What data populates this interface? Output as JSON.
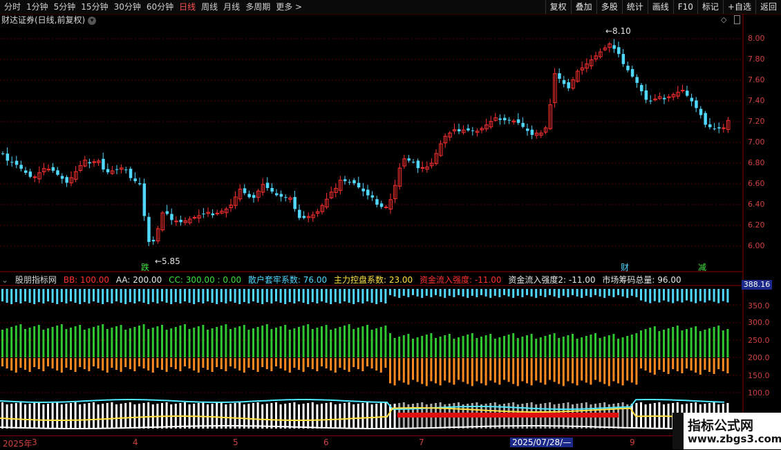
{
  "toolbar": {
    "periods": [
      "分时",
      "1分钟",
      "5分钟",
      "15分钟",
      "30分钟",
      "60分钟",
      "日线",
      "周线",
      "月线",
      "多周期",
      "更多 >"
    ],
    "active_period": "日线",
    "tools": [
      "复权",
      "叠加",
      "多股",
      "统计",
      "画线",
      "F10",
      "标记",
      "+自选",
      "返回"
    ]
  },
  "title": "财达证券(日线,前复权)",
  "price_axis": [
    "8.00",
    "7.80",
    "7.60",
    "7.40",
    "7.20",
    "7.00",
    "6.80",
    "6.60",
    "6.40",
    "6.20",
    "6.00"
  ],
  "annotations": {
    "high": "8.10",
    "low": "5.85",
    "fall_marker": "跌",
    "finance_marker": "财",
    "reduce_marker": "减"
  },
  "indicator": {
    "name": "股朋指标网",
    "items": [
      {
        "text": "BB: 100.00",
        "color": "#ff3030"
      },
      {
        "text": "AA: 200.00",
        "color": "#e8e8e8"
      },
      {
        "text": "CC: 300.00 : 0.00",
        "color": "#40e040"
      },
      {
        "text": "散户套牢系数: 76.00",
        "color": "#50d8ff"
      },
      {
        "text": "主力控盘系数: 23.00",
        "color": "#ffe040"
      },
      {
        "text": "资金流入强度: -11.00",
        "color": "#ff3030"
      },
      {
        "text": "资金流入强度2: -11.00",
        "color": "#e8e8e8"
      },
      {
        "text": "市场筹码总量: 96.00",
        "color": "#e8e8e8"
      }
    ],
    "badge": "388.16",
    "axis": [
      "350.0",
      "300.0",
      "250.0",
      "200.0",
      "150.0",
      "100.0"
    ]
  },
  "dates": {
    "year": "2025年",
    "months": [
      "3",
      "4",
      "5",
      "6",
      "7",
      "9"
    ],
    "cursor": "2025/07/28/—"
  },
  "watermark": {
    "line1": "指标公式网",
    "line2": "www.zbgs3.com"
  },
  "colors": {
    "up": "#ff3030",
    "down": "#50d8ff",
    "axis": "#d04040",
    "grid": "#5a0000"
  }
}
